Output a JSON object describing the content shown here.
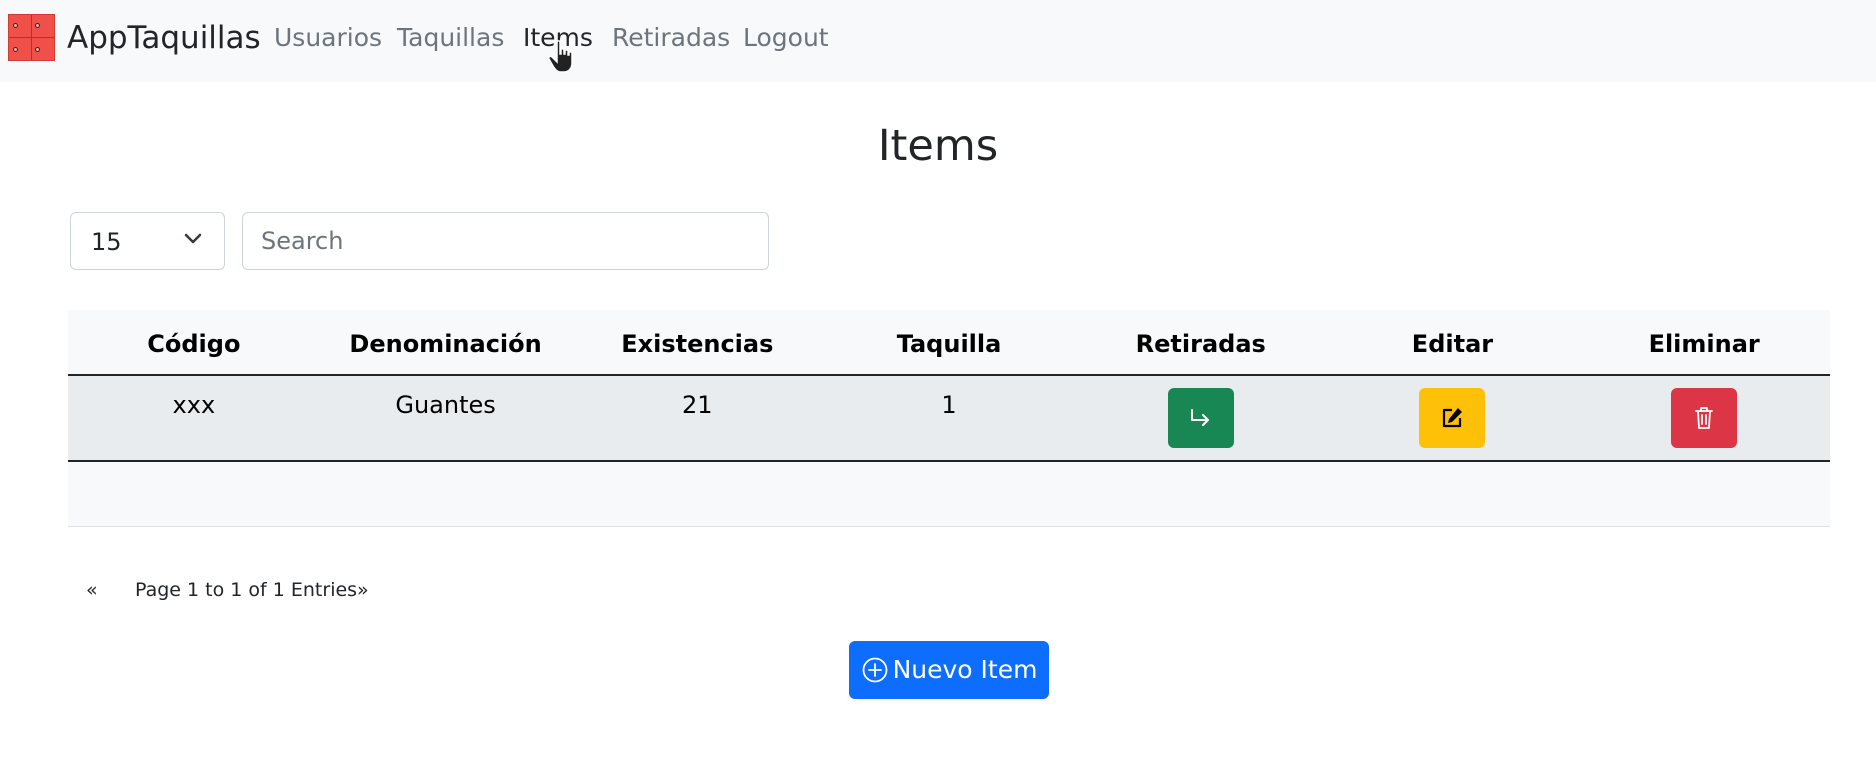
{
  "navbar": {
    "brand": "AppTaquillas",
    "links": [
      "Usuarios",
      "Taquillas",
      "Items",
      "Retiradas",
      "Logout"
    ],
    "active": "Items"
  },
  "page": {
    "title": "Items"
  },
  "controls": {
    "page_size": "15",
    "search_placeholder": "Search",
    "search_value": ""
  },
  "table": {
    "columns": [
      "Código",
      "Denominación",
      "Existencias",
      "Taquilla",
      "Retiradas",
      "Editar",
      "Eliminar"
    ],
    "rows": [
      {
        "codigo": "xxx",
        "denominacion": "Guantes",
        "existencias": "21",
        "taquilla": "1"
      }
    ]
  },
  "pagination": {
    "prev": "«",
    "info": "Page 1 to 1 of 1 Entries",
    "next": "»"
  },
  "actions": {
    "new_label": "Nuevo Item"
  },
  "colors": {
    "navbar_bg": "#f8f9fa",
    "primary": "#0d6efd",
    "success": "#198754",
    "warning": "#ffc107",
    "danger": "#dc3545",
    "logo": "#f0504a"
  },
  "icons": {
    "logo": "lockers-logo-icon",
    "cursor": "hand-cursor-icon",
    "select": "chevron-down-icon",
    "retiradas": "arrow-return-right-icon",
    "editar": "pencil-square-icon",
    "eliminar": "trash-icon",
    "nuevo": "plus-circle-icon"
  }
}
